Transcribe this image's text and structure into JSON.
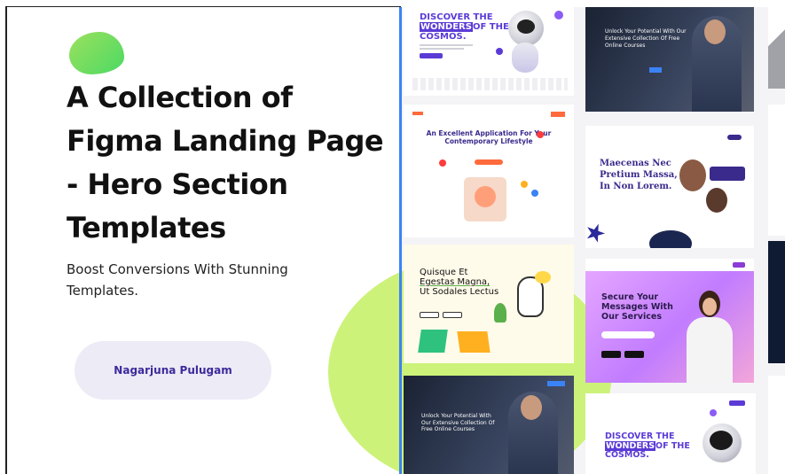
{
  "hero": {
    "title_part1": "A Collection of Figma Landing Page - ",
    "title_bold1": "Hero",
    "title_space": " ",
    "title_bold2": "Section",
    "title_part2": " Templates",
    "subtitle": "Boost Conversions With Stunning Templates.",
    "author": "Nagarjuna Pulugam"
  },
  "colors": {
    "accent_purple": "#3d2a9c",
    "blob_green": "#7ddb5e",
    "divider_blue": "#3b82f6",
    "collage_green": "#ccf27a"
  },
  "collage": {
    "cosmos": {
      "line1": "DISCOVER THE",
      "highlight": "WONDERS",
      "line2_rest": "OF THE",
      "line3": "COSMOS."
    },
    "students": {
      "headline": "Unlock Your Potential With Our Extensive Collection Of Free Online Courses"
    },
    "app": {
      "headline": "An Excellent Application For Your Contemporary Lifestyle"
    },
    "maecenas": {
      "headline": "Maecenas Nec Pretium Massa, In Non Lorem."
    },
    "quisque": {
      "line1": "Quisque Et",
      "line2": "Egestas Magna,",
      "line3": "Ut Sodales Lectus"
    },
    "secure": {
      "headline": "Secure Your Messages With Our Services"
    },
    "students2": {
      "headline": "Unlock Your Potential With Our Extensive Collection Of Free Online Courses"
    },
    "cosmos2": {
      "line1": "DISCOVER THE",
      "highlight": "WONDERS",
      "line2_rest": "OF THE",
      "line3": "COSMOS."
    }
  }
}
